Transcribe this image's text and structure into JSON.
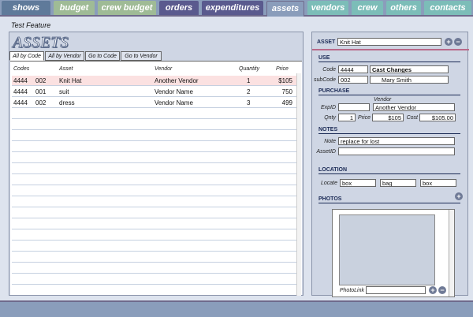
{
  "nav": {
    "tabs": [
      {
        "label": "shows",
        "color": "#5f7a9a"
      },
      {
        "label": "budget",
        "color": "#9fbb96"
      },
      {
        "label": "crew budget",
        "color": "#9fbb96"
      },
      {
        "label": "orders",
        "color": "#5a5a8e"
      },
      {
        "label": "expenditures",
        "color": "#5a5a8e"
      },
      {
        "label": "assets",
        "color": "#8a9dbb",
        "active": true
      },
      {
        "label": "vendors",
        "color": "#7cbdb8"
      },
      {
        "label": "crew",
        "color": "#7cbdb8"
      },
      {
        "label": "others",
        "color": "#7cbdb8"
      },
      {
        "label": "contacts",
        "color": "#7cbdb8"
      }
    ]
  },
  "feature_title": "Test Feature",
  "list": {
    "title": "ASSETS",
    "subtabs": [
      "All by Code",
      "All by Vendor",
      "Go to Code",
      "Go to Vendor"
    ],
    "columns": [
      "Codes",
      "Asset",
      "Vendor",
      "Quantity",
      "Price"
    ],
    "rows": [
      {
        "code": "4444",
        "sub": "002",
        "asset": "Knit Hat",
        "vendor": "Another Vendor",
        "qty": "1",
        "price": "$105"
      },
      {
        "code": "4444",
        "sub": "001",
        "asset": "suit",
        "vendor": "Vendor Name",
        "qty": "2",
        "price": "750"
      },
      {
        "code": "4444",
        "sub": "002",
        "asset": "dress",
        "vendor": "Vendor Name",
        "qty": "3",
        "price": "499"
      }
    ]
  },
  "detail": {
    "asset_label": "ASSET",
    "asset_value": "Knit Hat",
    "use_header": "USE",
    "code_label": "Code",
    "code_value": "4444",
    "code_name": "Cast Changes",
    "subcode_label": "subCode",
    "subcode_value": "002",
    "subcode_name": "Mary Smith",
    "purchase_header": "PURCHASE",
    "vendor_label": "Vendor",
    "expid_label": "ExpID",
    "expid_value": "",
    "vendor_value": "Another Vendor",
    "qnty_label": "Qnty",
    "qnty_value": "1",
    "price_label": "Price",
    "price_value": "$105",
    "cost_label": "Cost",
    "cost_value": "$105.00",
    "notes_header": "NOTES",
    "note_label": "Note",
    "note_value": "replace for lost",
    "assetid_label": "AssetID",
    "assetid_value": "",
    "location_header": "LOCATION",
    "locate_label": "Locate",
    "locate_values": [
      "box",
      "bag",
      "box"
    ],
    "photos_header": "PHOTOS",
    "photolink_label": "PhotoLink",
    "photolink_value": ""
  }
}
